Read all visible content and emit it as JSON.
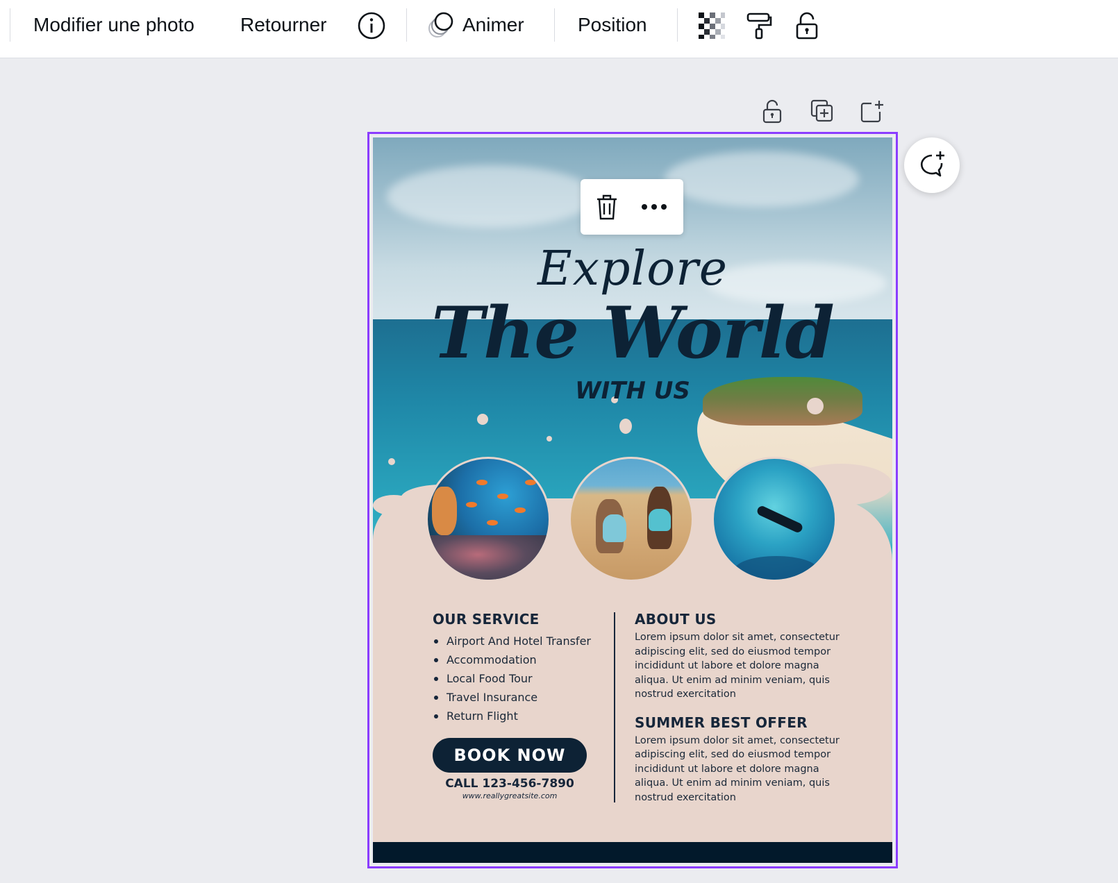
{
  "toolbar": {
    "edit_photo": "Modifier une photo",
    "flip": "Retourner",
    "info_icon": "info-icon",
    "animate": "Animer",
    "position": "Position",
    "transparency_icon": "transparency-icon",
    "copy_style_icon": "paint-roller-icon",
    "lock_icon": "lock-icon"
  },
  "canvas_actions": {
    "lock_icon": "lock-icon",
    "duplicate_icon": "duplicate-page-icon",
    "add_page_icon": "add-page-icon",
    "comment_icon": "add-comment-icon"
  },
  "floating_menu": {
    "delete_icon": "trash-icon",
    "more_icon": "more-icon"
  },
  "flyer": {
    "title_line1": "Explore",
    "title_line2": "The World",
    "title_line3": "WITH US",
    "service_title": "OUR SERVICE",
    "services": [
      "Airport And Hotel Transfer",
      "Accommodation",
      "Local Food Tour",
      "Travel Insurance",
      "Return Flight"
    ],
    "about_title": "ABOUT US",
    "about_text": "Lorem ipsum dolor sit amet, consectetur adipiscing elit, sed do eiusmod tempor incididunt ut labore et dolore magna aliqua. Ut enim ad minim veniam, quis nostrud exercitation",
    "offer_title": "SUMMER BEST OFFER",
    "offer_text": "Lorem ipsum dolor sit amet, consectetur adipiscing elit, sed do eiusmod tempor incididunt ut labore et dolore magna aliqua. Ut enim ad minim veniam, quis nostrud exercitation",
    "book_button": "BOOK NOW",
    "phone": "CALL 123-456-7890",
    "website": "www.reallygreatsite.com"
  },
  "colors": {
    "selection": "#8b3dff",
    "navy": "#0d2235",
    "sand": "#e8d5cc"
  }
}
